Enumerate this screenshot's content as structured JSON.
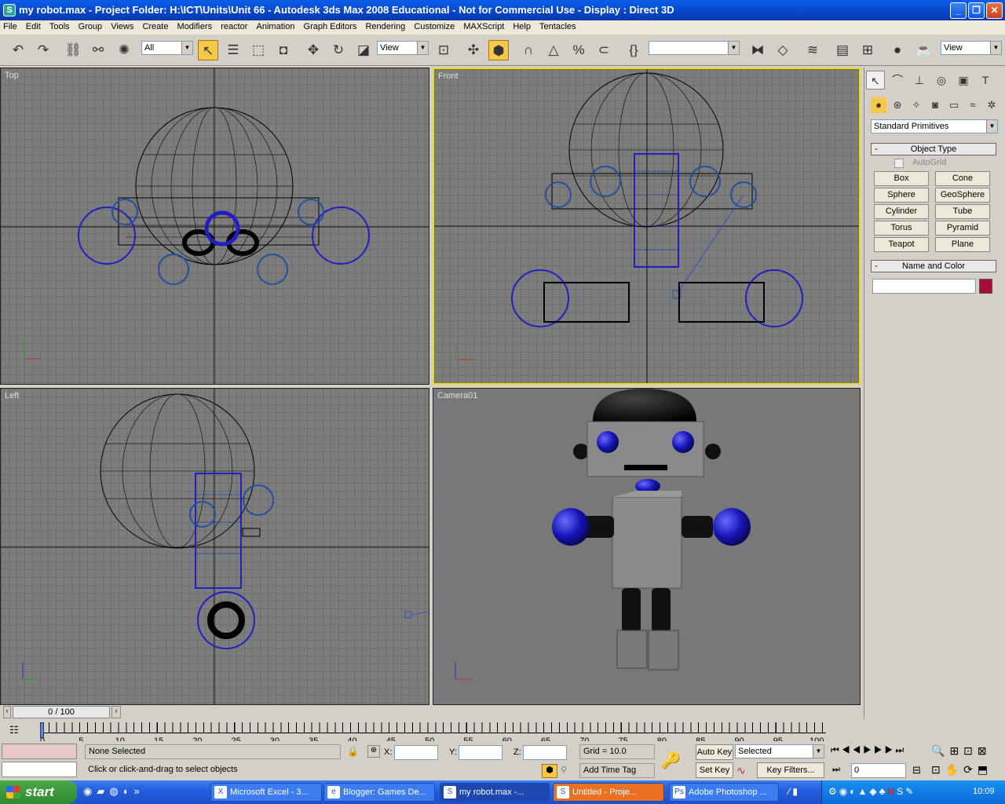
{
  "window": {
    "title": "my robot.max     - Project Folder: H:\\ICT\\Units\\Unit 66     - Autodesk 3ds Max 2008   Educational - Not for Commercial Use     - Display : Direct 3D",
    "app_icon": "3ds-max-icon"
  },
  "menu": [
    "File",
    "Edit",
    "Tools",
    "Group",
    "Views",
    "Create",
    "Modifiers",
    "reactor",
    "Animation",
    "Graph Editors",
    "Rendering",
    "Customize",
    "MAXScript",
    "Help",
    "Tentacles"
  ],
  "toolbar": {
    "selection_filter": "All",
    "reference_coord": "View",
    "named_selection": "",
    "view_dropdown": "View"
  },
  "viewports": {
    "top": {
      "label": "Top"
    },
    "front": {
      "label": "Front"
    },
    "left": {
      "label": "Left"
    },
    "camera": {
      "label": "Camera01"
    }
  },
  "command_panel": {
    "category": "Standard Primitives",
    "object_type": {
      "title": "Object Type",
      "autogrid": "AutoGrid",
      "buttons": [
        "Box",
        "Cone",
        "Sphere",
        "GeoSphere",
        "Cylinder",
        "Tube",
        "Torus",
        "Pyramid",
        "Teapot",
        "Plane"
      ]
    },
    "name_color": {
      "title": "Name and Color",
      "name": "",
      "color": "#a0103a"
    }
  },
  "timeline": {
    "frame": "0 / 100",
    "ticks": [
      "0",
      "5",
      "10",
      "15",
      "20",
      "25",
      "30",
      "35",
      "40",
      "45",
      "50",
      "55",
      "60",
      "65",
      "70",
      "75",
      "80",
      "85",
      "90",
      "95",
      "100"
    ]
  },
  "status": {
    "selection": "None Selected",
    "prompt": "Click or click-and-drag to select objects",
    "x_label": "X:",
    "y_label": "Y:",
    "z_label": "Z:",
    "grid": "Grid = 10.0",
    "add_time_tag": "Add Time Tag",
    "auto_key": "Auto Key",
    "set_key": "Set Key",
    "key_mode": "Selected",
    "key_filters": "Key Filters...",
    "current_frame": "0"
  },
  "taskbar": {
    "start": "start",
    "tasks": [
      "Microsoft Excel - 3...",
      "Blogger: Games De...",
      "my robot.max     -...",
      "Untitled     - Proje...",
      "Adobe Photoshop ..."
    ],
    "clock": "10:09"
  }
}
